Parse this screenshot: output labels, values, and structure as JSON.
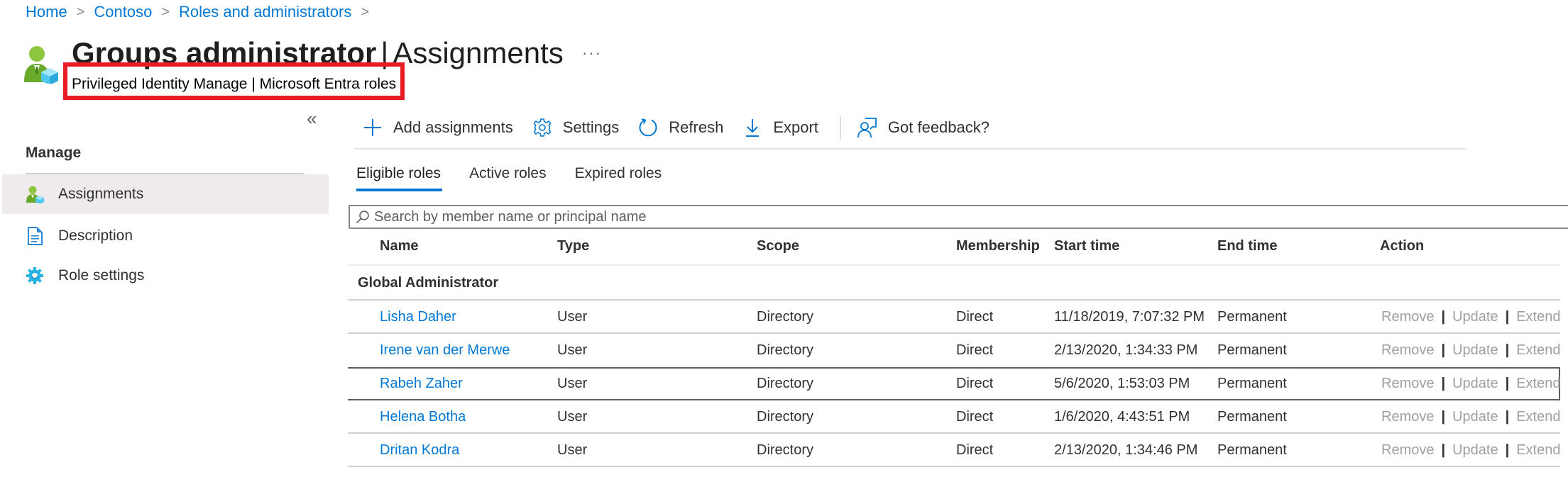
{
  "breadcrumb": {
    "items": [
      "Home",
      "Contoso",
      "Roles and administrators"
    ],
    "separator": ">"
  },
  "header": {
    "title_strong": "Groups administrator",
    "title_separator": "|",
    "title_light": "Assignments",
    "more_label": "···",
    "subtitle": "Privileged Identity Manage | Microsoft Entra roles",
    "highlight_color": "#e81c24"
  },
  "sidebar": {
    "collapse_label": "«",
    "heading": "Manage",
    "items": [
      {
        "label": "Assignments",
        "icon": "assignments-icon",
        "active": true
      },
      {
        "label": "Description",
        "icon": "document-icon",
        "active": false
      },
      {
        "label": "Role settings",
        "icon": "gear-icon",
        "active": false
      }
    ]
  },
  "toolbar": {
    "add_label": "Add assignments",
    "settings_label": "Settings",
    "refresh_label": "Refresh",
    "export_label": "Export",
    "feedback_label": "Got feedback?"
  },
  "tabs": [
    {
      "label": "Eligible roles",
      "active": true
    },
    {
      "label": "Active roles",
      "active": false
    },
    {
      "label": "Expired roles",
      "active": false
    }
  ],
  "search": {
    "placeholder": "Search by member name or principal name",
    "value": ""
  },
  "table": {
    "columns": [
      "Name",
      "Type",
      "Scope",
      "Membership",
      "Start time",
      "End time",
      "Action"
    ],
    "group": "Global Administrator",
    "rows": [
      {
        "name": "Lisha Daher",
        "type": "User",
        "scope": "Directory",
        "membership": "Direct",
        "start": "11/18/2019, 7:07:32 PM",
        "end": "Permanent"
      },
      {
        "name": "Irene van der Merwe",
        "type": "User",
        "scope": "Directory",
        "membership": "Direct",
        "start": "2/13/2020, 1:34:33 PM",
        "end": "Permanent"
      },
      {
        "name": "Rabeh Zaher",
        "type": "User",
        "scope": "Directory",
        "membership": "Direct",
        "start": "5/6/2020, 1:53:03 PM",
        "end": "Permanent"
      },
      {
        "name": "Helena Botha",
        "type": "User",
        "scope": "Directory",
        "membership": "Direct",
        "start": "1/6/2020, 4:43:51 PM",
        "end": "Permanent"
      },
      {
        "name": "Dritan Kodra",
        "type": "User",
        "scope": "Directory",
        "membership": "Direct",
        "start": "2/13/2020, 1:34:46 PM",
        "end": "Permanent"
      }
    ],
    "actions": {
      "remove": "Remove",
      "update": "Update",
      "extend": "Extend",
      "separator": "|"
    }
  },
  "colors": {
    "link": "#0078d4",
    "action_disabled": "#a19f9d",
    "tab_indicator": "#0078d4"
  }
}
